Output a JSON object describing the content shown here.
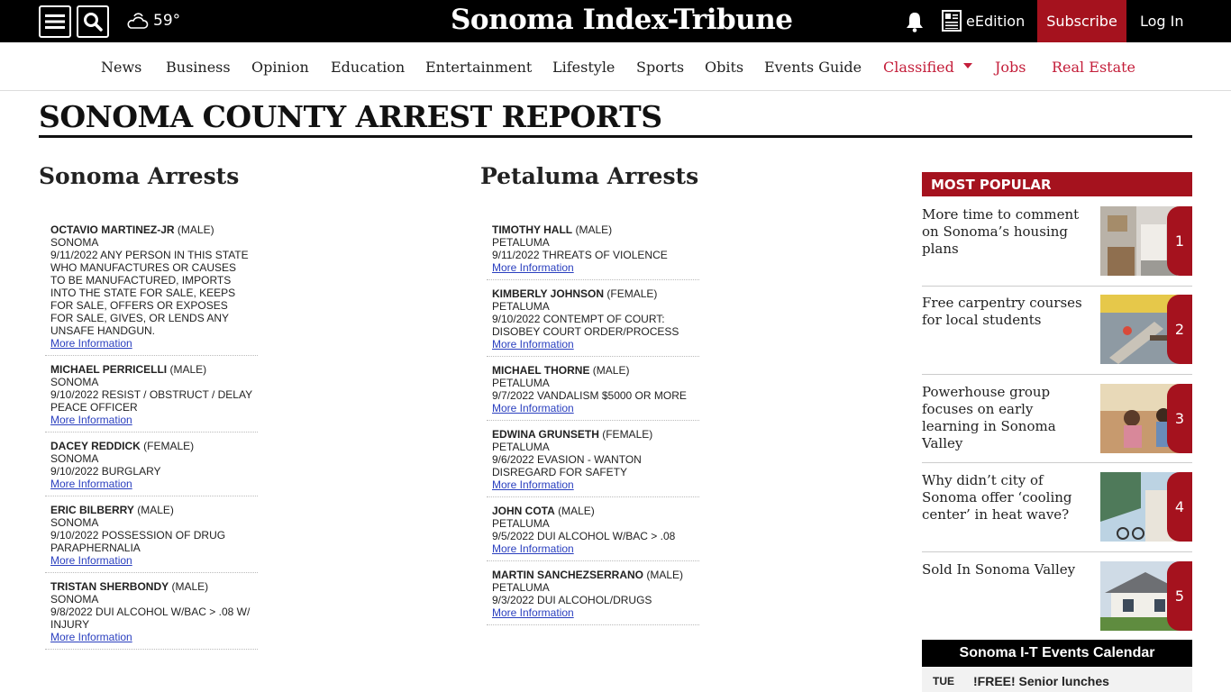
{
  "header": {
    "weather_temp": "59°",
    "logo": "Sonoma Index-Tribune",
    "edition_label": "eEdition",
    "subscribe_label": "Subscribe",
    "login_label": "Log In"
  },
  "nav": [
    {
      "label": "News"
    },
    {
      "label": "Business"
    },
    {
      "label": "Opinion"
    },
    {
      "label": "Education"
    },
    {
      "label": "Entertainment"
    },
    {
      "label": "Lifestyle"
    },
    {
      "label": "Sports"
    },
    {
      "label": "Obits"
    },
    {
      "label": "Events Guide"
    },
    {
      "label": "Classified"
    },
    {
      "label": "Jobs"
    },
    {
      "label": "Real Estate"
    }
  ],
  "page_title": "SONOMA COUNTY ARREST REPORTS",
  "sonoma": {
    "title": "Sonoma Arrests",
    "items": [
      {
        "name": "OCTAVIO MARTINEZ-JR",
        "gender": "(MALE)",
        "city": "SONOMA",
        "desc": "9/11/2022 ANY PERSON IN THIS STATE WHO MANUFACTURES OR CAUSES TO BE MANUFACTURED, IMPORTS INTO THE STATE FOR SALE, KEEPS FOR SALE, OFFERS OR EXPOSES FOR SALE, GIVES, OR LENDS ANY UNSAFE HANDGUN.",
        "link": "More Information"
      },
      {
        "name": "MICHAEL PERRICELLI",
        "gender": "(MALE)",
        "city": "SONOMA",
        "desc": "9/10/2022 RESIST / OBSTRUCT / DELAY PEACE OFFICER",
        "link": "More Information"
      },
      {
        "name": "DACEY REDDICK",
        "gender": "(FEMALE)",
        "city": "SONOMA",
        "desc": "9/10/2022 BURGLARY",
        "link": "More Information"
      },
      {
        "name": "ERIC BILBERRY",
        "gender": "(MALE)",
        "city": "SONOMA",
        "desc": "9/10/2022 POSSESSION OF DRUG PARAPHERNALIA",
        "link": "More Information"
      },
      {
        "name": "TRISTAN SHERBONDY",
        "gender": "(MALE)",
        "city": "SONOMA",
        "desc": "9/8/2022 DUI ALCOHOL W/BAC > .08 W/ INJURY",
        "link": "More Information"
      }
    ]
  },
  "petaluma": {
    "title": "Petaluma Arrests",
    "items": [
      {
        "name": "TIMOTHY HALL",
        "gender": "(MALE)",
        "city": "PETALUMA",
        "desc": "9/11/2022 THREATS OF VIOLENCE",
        "link": "More Information"
      },
      {
        "name": "KIMBERLY JOHNSON",
        "gender": "(FEMALE)",
        "city": "PETALUMA",
        "desc": "9/10/2022 CONTEMPT OF COURT: DISOBEY COURT ORDER/PROCESS",
        "link": "More Information"
      },
      {
        "name": "MICHAEL THORNE",
        "gender": "(MALE)",
        "city": "PETALUMA",
        "desc": "9/7/2022 VANDALISM $5000 OR MORE",
        "link": "More Information"
      },
      {
        "name": "EDWINA GRUNSETH",
        "gender": "(FEMALE)",
        "city": "PETALUMA",
        "desc": "9/6/2022 EVASION - WANTON DISREGARD FOR SAFETY",
        "link": "More Information"
      },
      {
        "name": "JOHN COTA",
        "gender": "(MALE)",
        "city": "PETALUMA",
        "desc": "9/5/2022 DUI ALCOHOL W/BAC > .08",
        "link": "More Information"
      },
      {
        "name": "MARTIN SANCHEZSERRANO",
        "gender": "(MALE)",
        "city": "PETALUMA",
        "desc": "9/3/2022 DUI ALCOHOL/DRUGS",
        "link": "More Information"
      }
    ]
  },
  "popular": {
    "title": "MOST POPULAR",
    "items": [
      {
        "rank": "1",
        "title": "More time to comment on Sonoma’s housing plans"
      },
      {
        "rank": "2",
        "title": "Free carpentry courses for local students"
      },
      {
        "rank": "3",
        "title": "Powerhouse group focuses on early learning in Sonoma Valley"
      },
      {
        "rank": "4",
        "title": "Why didn’t city of Sonoma offer ‘cooling center’ in heat wave?"
      },
      {
        "rank": "5",
        "title": "Sold In Sonoma Valley"
      }
    ]
  },
  "calendar": {
    "title": "Sonoma I-T Events Calendar",
    "day": "TUE",
    "event": "!FREE! Senior lunches"
  },
  "colors": {
    "brand_red": "#a5121e",
    "nav_red": "#c41e3a",
    "link_blue": "#2a3fbf"
  }
}
